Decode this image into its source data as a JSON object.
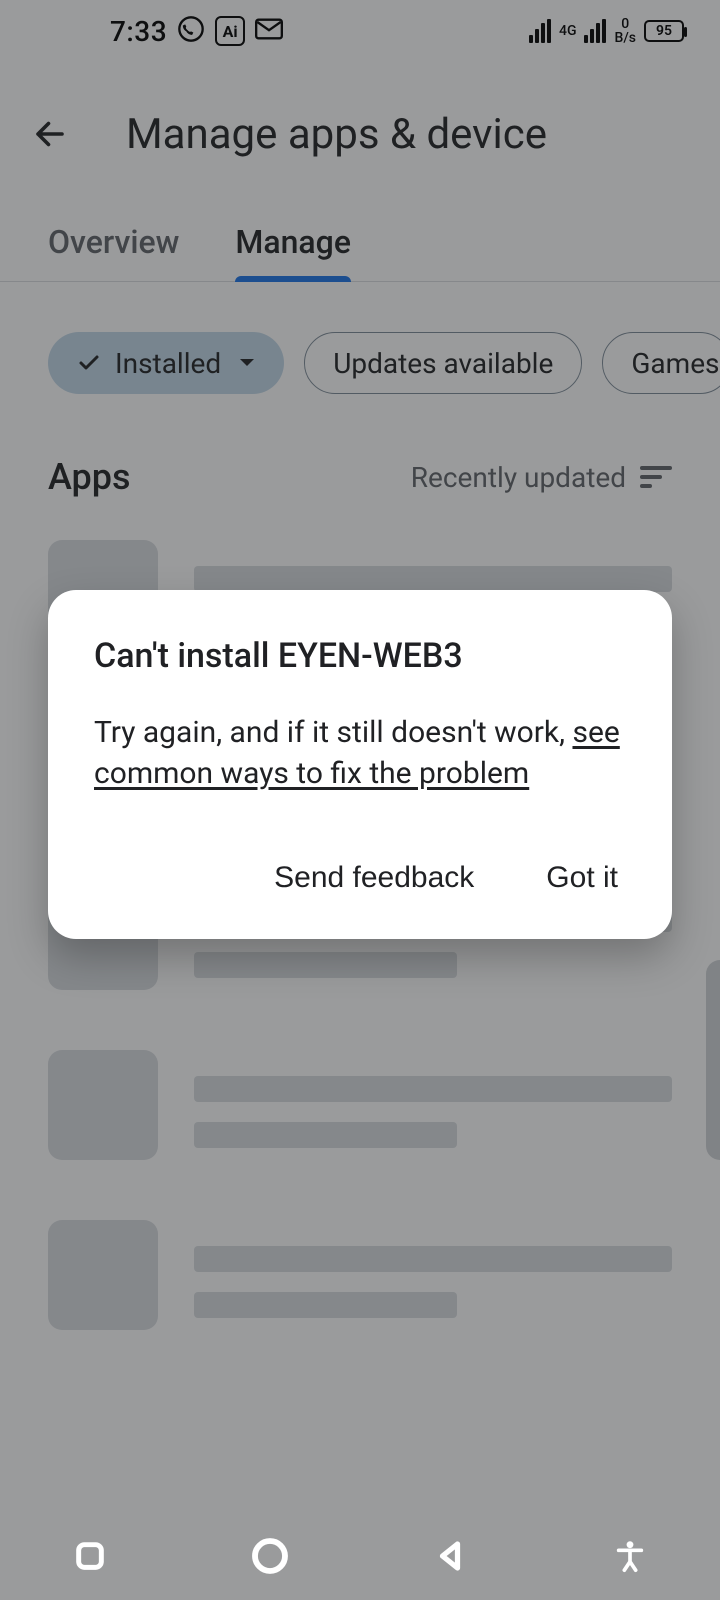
{
  "status_bar": {
    "time": "7:33",
    "ai_label": "Ai",
    "net_gen": "4G",
    "data_rate_top": "0",
    "data_rate_unit": "B/s",
    "battery": "95"
  },
  "header": {
    "title": "Manage apps & device"
  },
  "tabs": {
    "overview": "Overview",
    "manage": "Manage"
  },
  "chips": {
    "installed": "Installed",
    "updates": "Updates available",
    "games": "Games"
  },
  "section": {
    "title": "Apps",
    "sort": "Recently updated"
  },
  "dialog": {
    "title": "Can't install EYEN-WEB3",
    "body_pre": "Try again, and if it still doesn't work, ",
    "body_link": "see common ways to fix the problem",
    "action_feedback": "Send feedback",
    "action_ok": "Got it"
  }
}
